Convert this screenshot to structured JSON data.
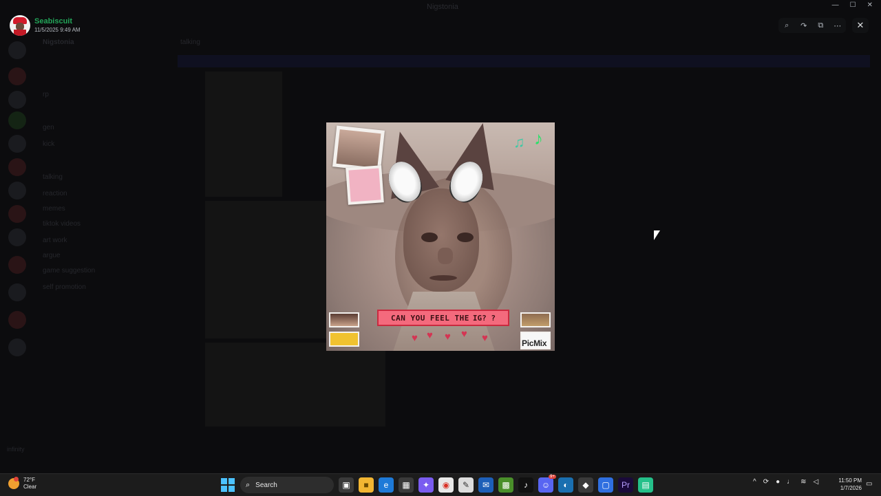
{
  "app": {
    "window_title": "Nigstonia"
  },
  "background": {
    "server_name": "Nigstonia",
    "channels": [
      "rp",
      "gen",
      "kick",
      "talking",
      "reaction",
      "memes",
      "tiktok videos",
      "art work",
      "argue",
      "game suggestion",
      "self promotion"
    ],
    "current_channel": "talking",
    "user_panel_name": "infinity"
  },
  "viewer": {
    "username": "Seabiscuit",
    "timestamp": "11/5/2025 9:49 AM",
    "tools": [
      {
        "name": "zoom-icon",
        "glyph": "⌕"
      },
      {
        "name": "forward-icon",
        "glyph": "↷"
      },
      {
        "name": "open-external-icon",
        "glyph": "⧉"
      },
      {
        "name": "more-icon",
        "glyph": "⋯"
      }
    ],
    "close_glyph": "✕"
  },
  "image": {
    "banner_text": "CAN YOU FEEL THE",
    "banner_end": "IG? ?",
    "watermark": "PicMix"
  },
  "taskbar": {
    "weather_temp": "72°F",
    "weather_cond": "Clear",
    "search_placeholder": "Search",
    "discord_badge": "9+",
    "time": "11:50 PM",
    "date": "1/7/2026"
  },
  "colors": {
    "username": "#23a559",
    "banner_fill": "#f46a7d",
    "taskbar": "#1c1c1c"
  }
}
